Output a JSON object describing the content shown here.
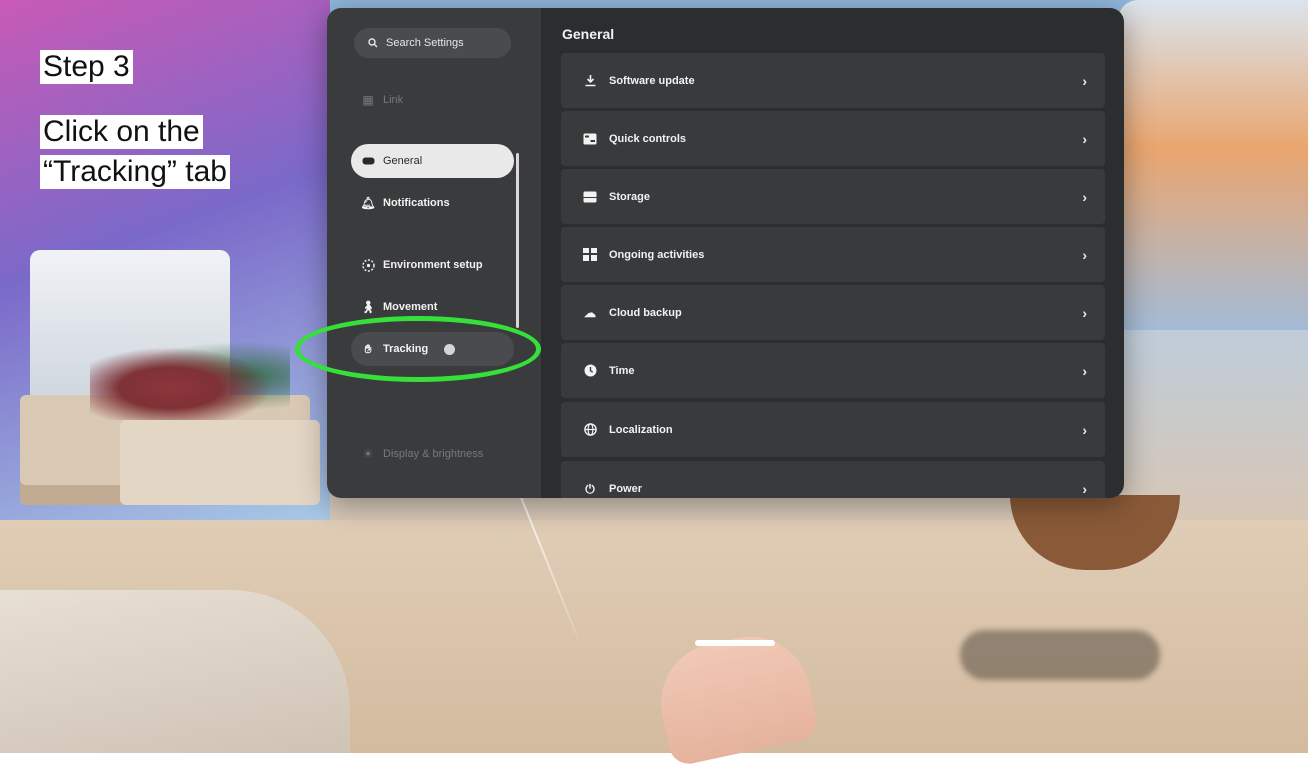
{
  "annotation": {
    "step": "Step 3",
    "instruction_line1": "Click on the",
    "instruction_line2": "“Tracking” tab",
    "highlight_color": "#35e03a"
  },
  "sidebar": {
    "search_placeholder": "Search Settings",
    "items": [
      {
        "label": "Link",
        "icon": "link-icon",
        "state": "faded"
      },
      {
        "label": "General",
        "icon": "headset-icon",
        "state": "selected"
      },
      {
        "label": "Notifications",
        "icon": "bell-icon",
        "state": "normal"
      },
      {
        "label": "Environment setup",
        "icon": "boundary-icon",
        "state": "normal"
      },
      {
        "label": "Movement",
        "icon": "walking-icon",
        "state": "normal"
      },
      {
        "label": "Tracking",
        "icon": "hand-tracking-icon",
        "state": "hover"
      },
      {
        "label": "Display & brightness",
        "icon": "sun-icon",
        "state": "faded"
      }
    ]
  },
  "main": {
    "title": "General",
    "rows": [
      {
        "label": "Software update",
        "icon": "download-icon"
      },
      {
        "label": "Quick controls",
        "icon": "controls-icon"
      },
      {
        "label": "Storage",
        "icon": "storage-icon"
      },
      {
        "label": "Ongoing activities",
        "icon": "grid-icon"
      },
      {
        "label": "Cloud backup",
        "icon": "cloud-icon"
      },
      {
        "label": "Time",
        "icon": "clock-icon"
      },
      {
        "label": "Localization",
        "icon": "globe-icon"
      },
      {
        "label": "Power",
        "icon": "power-icon"
      }
    ]
  }
}
